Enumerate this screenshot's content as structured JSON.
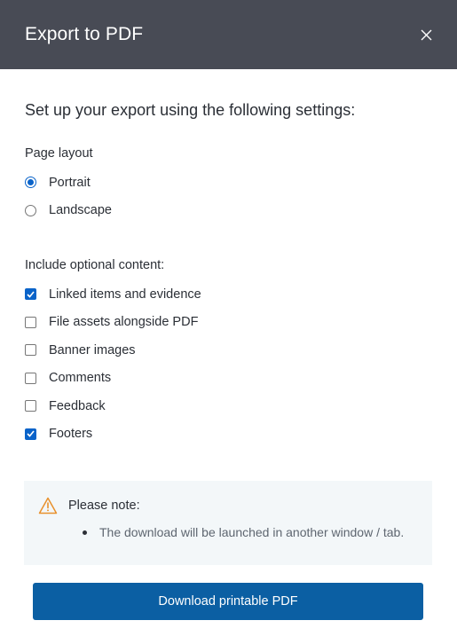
{
  "dialog": {
    "title": "Export to PDF",
    "intro": "Set up your export using the following settings:"
  },
  "page_layout": {
    "label": "Page layout",
    "options": [
      {
        "label": "Portrait",
        "selected": true
      },
      {
        "label": "Landscape",
        "selected": false
      }
    ]
  },
  "optional_content": {
    "label": "Include optional content:",
    "items": [
      {
        "label": "Linked items and evidence",
        "checked": true
      },
      {
        "label": "File assets alongside PDF",
        "checked": false
      },
      {
        "label": "Banner images",
        "checked": false
      },
      {
        "label": "Comments",
        "checked": false
      },
      {
        "label": "Feedback",
        "checked": false
      },
      {
        "label": "Footers",
        "checked": true
      }
    ]
  },
  "note": {
    "heading": "Please note:",
    "items": [
      "The download will be launched in another window / tab."
    ]
  },
  "actions": {
    "download_label": "Download printable PDF"
  },
  "colors": {
    "header_bg": "#484b55",
    "accent": "#0a63c9",
    "button_bg": "#0b5fa3",
    "note_bg": "#f3f7f9",
    "warning": "#e8912d"
  },
  "icons": {
    "close": "close-icon",
    "warning": "warning-icon"
  }
}
